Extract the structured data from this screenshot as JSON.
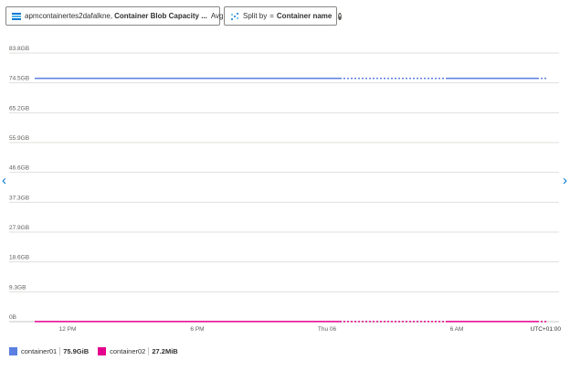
{
  "filters": {
    "metric": {
      "resource": "apmcontainertes2dafalkne,",
      "metric_name": "Container Blob Capacity ...",
      "aggregation": "Avg"
    },
    "split": {
      "label": "Split by",
      "separator": "=",
      "value": "Container name"
    }
  },
  "colors": {
    "container01": "#5b7fe0",
    "container02": "#e3008c",
    "grid": "#e1dfdd",
    "axis_text": "#605e5c"
  },
  "chart_data": {
    "type": "line",
    "y_unit": "GB",
    "y_ticks": [
      "83.8GB",
      "74.5GB",
      "65.2GB",
      "55.9GB",
      "46.6GB",
      "37.3GB",
      "27.9GB",
      "18.6GB",
      "9.3GB",
      "0B"
    ],
    "ylim": [
      0,
      83.8
    ],
    "x_ticks": [
      "12 PM",
      "6 PM",
      "Thu 06",
      "6 AM"
    ],
    "x_note": "UTC+01:00",
    "grid": true,
    "legend_position": "bottom-left",
    "series": [
      {
        "name": "container01",
        "summary": "75.9GiB",
        "segments": [
          {
            "style": "solid",
            "start": "start",
            "end": "Thu 06 + 1h",
            "value": 75.9
          },
          {
            "style": "dotted",
            "start": "Thu 06 + 1h",
            "end": "6 AM",
            "value": 75.9
          },
          {
            "style": "solid",
            "start": "6 AM",
            "end": "end-4h",
            "value": 75.9
          },
          {
            "style": "dotted",
            "start": "end-4h",
            "end": "end",
            "value": 75.9
          }
        ]
      },
      {
        "name": "container02",
        "summary": "27.2MiB",
        "segments": [
          {
            "style": "solid",
            "start": "start",
            "end": "Thu 06 + 1h",
            "value": 0.027
          },
          {
            "style": "dotted",
            "start": "Thu 06 + 1h",
            "end": "6 AM",
            "value": 0.027
          },
          {
            "style": "solid",
            "start": "6 AM",
            "end": "end-4h",
            "value": 0.027
          },
          {
            "style": "dotted",
            "start": "end-4h",
            "end": "end",
            "value": 0.027
          }
        ]
      }
    ]
  }
}
